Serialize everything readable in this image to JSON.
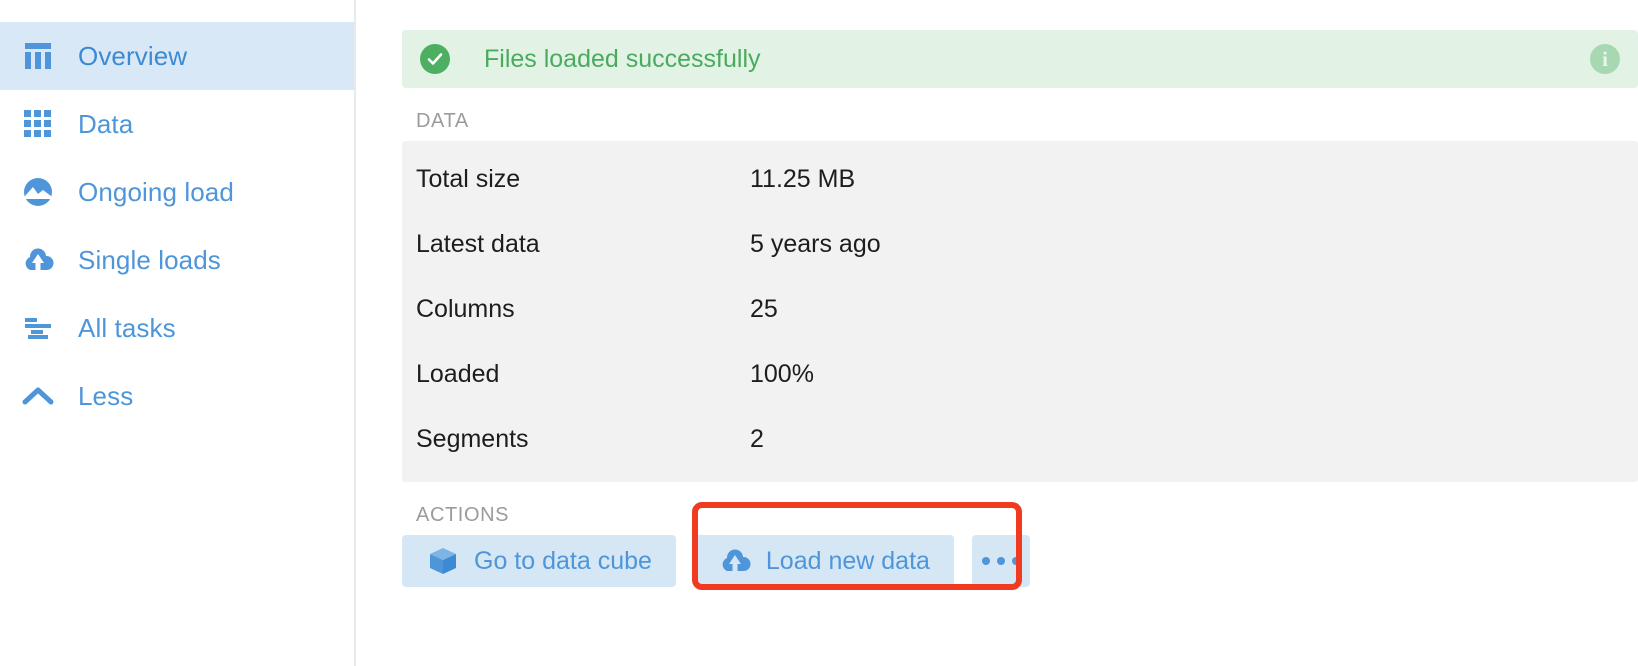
{
  "sidebar": {
    "items": [
      {
        "label": "Overview",
        "icon": "table-columns-icon",
        "active": true
      },
      {
        "label": "Data",
        "icon": "grid-icon",
        "active": false
      },
      {
        "label": "Ongoing load",
        "icon": "activity-circle-icon",
        "active": false
      },
      {
        "label": "Single loads",
        "icon": "cloud-upload-icon",
        "active": false
      },
      {
        "label": "All tasks",
        "icon": "task-list-icon",
        "active": false
      },
      {
        "label": "Less",
        "icon": "chevron-up-icon",
        "active": false
      }
    ]
  },
  "banner": {
    "message": "Files loaded successfully",
    "status_icon": "check-circle-icon",
    "info_icon": "info-circle-icon",
    "info_glyph": "i",
    "background_color": "#e2f2e4",
    "text_color": "#4aab5f",
    "accent_color": "#4caf61"
  },
  "data_section": {
    "label": "DATA",
    "rows": [
      {
        "key": "Total size",
        "value": "11.25 MB"
      },
      {
        "key": "Latest data",
        "value": "5 years ago"
      },
      {
        "key": "Columns",
        "value": "25"
      },
      {
        "key": "Loaded",
        "value": "100%"
      },
      {
        "key": "Segments",
        "value": "2"
      }
    ]
  },
  "actions_section": {
    "label": "ACTIONS",
    "buttons": [
      {
        "label": "Go to data cube",
        "icon": "cube-icon",
        "highlighted": true
      },
      {
        "label": "Load new data",
        "icon": "cloud-upload-icon",
        "highlighted": false
      }
    ],
    "overflow": {
      "label": "•••",
      "icon": "ellipsis-icon"
    }
  },
  "theme": {
    "accent_blue": "#4e96d9",
    "button_bg": "#d5e6f5",
    "active_nav_bg": "#d9e8f6",
    "panel_bg": "#f2f2f2",
    "highlight_red": "#f03b20",
    "muted_label": "#9b9b9b"
  }
}
